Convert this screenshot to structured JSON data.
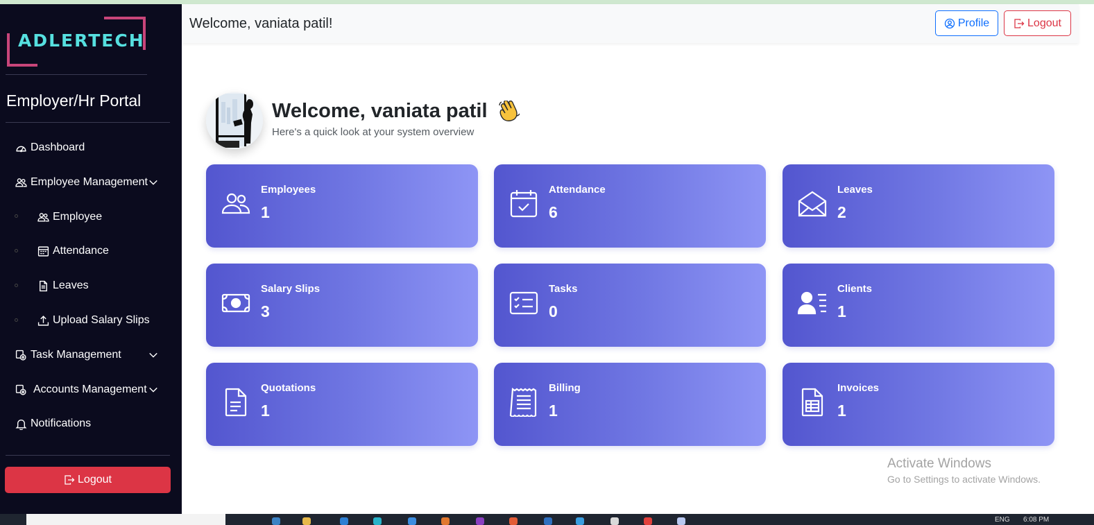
{
  "sidebar": {
    "logo_text": "ADLERTECH",
    "portal_title": "Employer/Hr Portal",
    "items": [
      {
        "label": "Dashboard",
        "icon": "speedometer-icon"
      },
      {
        "label": "Employee Management",
        "icon": "people-icon"
      },
      {
        "label": "Employee",
        "icon": "people-icon"
      },
      {
        "label": "Attendance",
        "icon": "calendar-icon"
      },
      {
        "label": "Leaves",
        "icon": "file-icon"
      },
      {
        "label": "Upload Salary Slips",
        "icon": "upload-icon"
      },
      {
        "label": "Task Management",
        "icon": "task-icon"
      },
      {
        "label": "Accounts Management",
        "icon": "accounts-icon"
      },
      {
        "label": "Notifications",
        "icon": "bell-icon"
      }
    ],
    "logout_label": "Logout"
  },
  "header": {
    "welcome": "Welcome, vaniata patil!",
    "profile_label": "Profile",
    "logout_label": "Logout"
  },
  "main": {
    "greeting": "Welcome, vaniata patil",
    "subtitle": "Here's a quick look at your system overview",
    "cards": [
      {
        "label": "Employees",
        "value": "1",
        "icon": "people-icon"
      },
      {
        "label": "Attendance",
        "value": "6",
        "icon": "calendar-check-icon"
      },
      {
        "label": "Leaves",
        "value": "2",
        "icon": "envelope-open-icon"
      },
      {
        "label": "Salary Slips",
        "value": "3",
        "icon": "cash-icon"
      },
      {
        "label": "Tasks",
        "value": "0",
        "icon": "card-checklist-icon"
      },
      {
        "label": "Clients",
        "value": "1",
        "icon": "person-lines-icon"
      },
      {
        "label": "Quotations",
        "value": "1",
        "icon": "file-text-icon"
      },
      {
        "label": "Billing",
        "value": "1",
        "icon": "receipt-icon"
      },
      {
        "label": "Invoices",
        "value": "1",
        "icon": "invoice-icon"
      }
    ]
  },
  "watermark": {
    "title": "Activate Windows",
    "subtitle": "Go to Settings to activate Windows."
  },
  "taskbar": {
    "lang": "ENG",
    "time": "6:08 PM"
  },
  "colors": {
    "sidebar_bg": "#0b0b1e",
    "card_gradient_start": "#5356cf",
    "card_gradient_end": "#8e95f5",
    "logout_red": "#dc3545",
    "profile_blue": "#0d6efd",
    "logo_cyan": "#56e0e0",
    "logo_pink": "#c8457a"
  }
}
